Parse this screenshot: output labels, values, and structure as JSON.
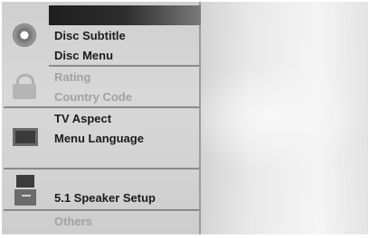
{
  "menu": {
    "items": [
      {
        "label": "Disc Subtitle",
        "active": true
      },
      {
        "label": "Disc Menu",
        "active": true
      },
      {
        "label": "Rating",
        "active": false
      },
      {
        "label": "Country Code",
        "active": false
      },
      {
        "label": "TV Aspect",
        "active": true
      },
      {
        "label": "Menu Language",
        "active": true
      },
      {
        "label": "5.1 Speaker Setup",
        "active": true
      },
      {
        "label": "Others",
        "active": false
      }
    ]
  },
  "icons": [
    "disc-icon",
    "lock-icon",
    "tv-icon",
    "speaker-icon"
  ]
}
